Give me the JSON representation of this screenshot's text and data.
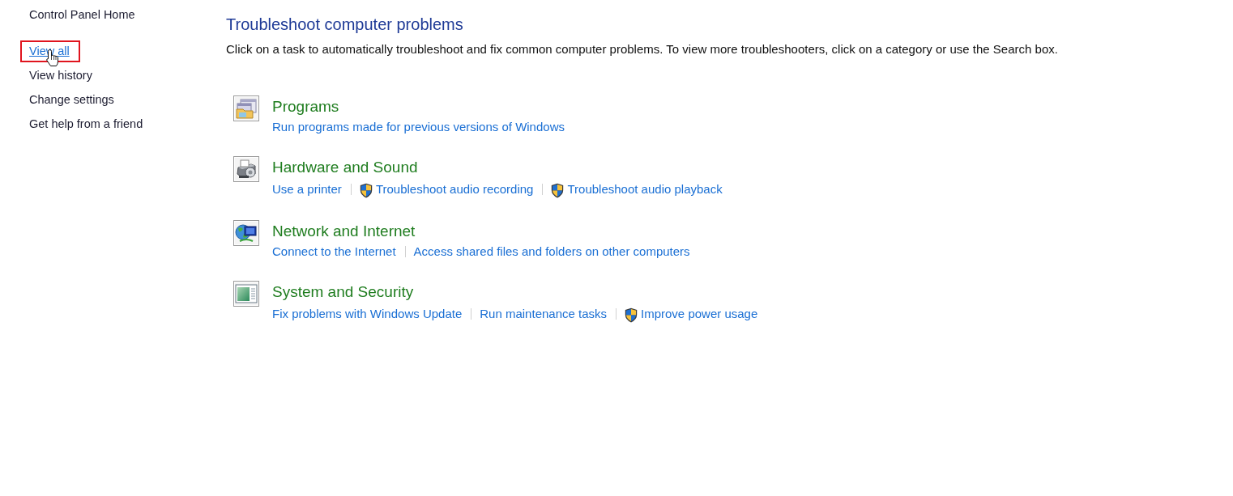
{
  "sidebar": {
    "items": [
      {
        "label": "Control Panel Home",
        "kind": "home",
        "hovered": false,
        "highlighted": false
      },
      {
        "label": "View all",
        "kind": "task",
        "hovered": true,
        "highlighted": true
      },
      {
        "label": "View history",
        "kind": "task",
        "hovered": false,
        "highlighted": false
      },
      {
        "label": "Change settings",
        "kind": "task",
        "hovered": false,
        "highlighted": false
      },
      {
        "label": "Get help from a friend",
        "kind": "task",
        "hovered": false,
        "highlighted": false
      }
    ]
  },
  "main": {
    "title": "Troubleshoot computer problems",
    "description": "Click on a task to automatically troubleshoot and fix common computer problems. To view more troubleshooters, click on a category or use the Search box.",
    "categories": [
      {
        "kind": "programs",
        "title": "Programs",
        "links": [
          {
            "label": "Run programs made for previous versions of Windows",
            "shield": false
          }
        ]
      },
      {
        "kind": "hardware",
        "title": "Hardware and Sound",
        "links": [
          {
            "label": "Use a printer",
            "shield": false
          },
          {
            "label": "Troubleshoot audio recording",
            "shield": true
          },
          {
            "label": "Troubleshoot audio playback",
            "shield": true
          }
        ]
      },
      {
        "kind": "network",
        "title": "Network and Internet",
        "links": [
          {
            "label": "Connect to the Internet",
            "shield": false
          },
          {
            "label": "Access shared files and folders on other computers",
            "shield": false
          }
        ]
      },
      {
        "kind": "system",
        "title": "System and Security",
        "links": [
          {
            "label": "Fix problems with Windows Update",
            "shield": false
          },
          {
            "label": "Run maintenance tasks",
            "shield": false
          },
          {
            "label": "Improve power usage",
            "shield": true
          }
        ]
      }
    ]
  }
}
